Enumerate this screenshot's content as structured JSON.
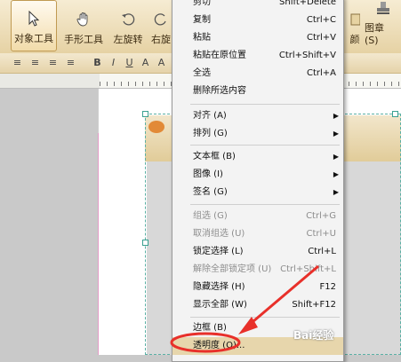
{
  "toolbar": {
    "items": [
      {
        "label": "对象工具",
        "icon": "cursor-icon"
      },
      {
        "label": "手形工具",
        "icon": "hand-icon"
      },
      {
        "label": "左旋转",
        "icon": "rotate-left-icon"
      },
      {
        "label": "右旋",
        "icon": "rotate-right-icon"
      },
      {
        "label": "颜",
        "icon": "color-icon"
      },
      {
        "label": "图章 (S)",
        "icon": "stamp-icon"
      }
    ]
  },
  "formatbar": {
    "buttons": [
      "B",
      "I",
      "U",
      "A",
      "A"
    ]
  },
  "menu": {
    "items": [
      {
        "label": "剪切",
        "shortcut": "Shift+Delete",
        "disabled": false
      },
      {
        "label": "复制",
        "shortcut": "Ctrl+C",
        "disabled": false
      },
      {
        "label": "粘贴",
        "shortcut": "Ctrl+V",
        "disabled": false
      },
      {
        "label": "粘贴在原位置",
        "shortcut": "Ctrl+Shift+V",
        "disabled": false
      },
      {
        "label": "全选",
        "shortcut": "Ctrl+A",
        "disabled": false
      },
      {
        "label": "删除所选内容",
        "shortcut": "",
        "disabled": false
      },
      {
        "label": "对齐 (A)",
        "shortcut": "",
        "submenu": true,
        "disabled": false
      },
      {
        "label": "排列 (G)",
        "shortcut": "",
        "submenu": true,
        "disabled": false
      },
      {
        "label": "文本框 (B)",
        "shortcut": "",
        "submenu": true,
        "disabled": false
      },
      {
        "label": "图像 (I)",
        "shortcut": "",
        "submenu": true,
        "disabled": false
      },
      {
        "label": "签名 (G)",
        "shortcut": "",
        "submenu": true,
        "disabled": false
      },
      {
        "label": "组选 (G)",
        "shortcut": "Ctrl+G",
        "disabled": true
      },
      {
        "label": "取消组选 (U)",
        "shortcut": "Ctrl+U",
        "disabled": true
      },
      {
        "label": "锁定选择 (L)",
        "shortcut": "Ctrl+L",
        "disabled": false
      },
      {
        "label": "解除全部锁定项 (U)",
        "shortcut": "Ctrl+Shift+L",
        "disabled": true
      },
      {
        "label": "隐藏选择 (H)",
        "shortcut": "F12",
        "disabled": false
      },
      {
        "label": "显示全部 (W)",
        "shortcut": "Shift+F12",
        "disabled": false
      },
      {
        "label": "边框 (B)",
        "shortcut": "",
        "disabled": false
      },
      {
        "label": "透明度 (O)...",
        "shortcut": "",
        "disabled": false
      }
    ]
  },
  "annotation": {
    "color": "#e8302a"
  },
  "watermark": "Bai经验"
}
